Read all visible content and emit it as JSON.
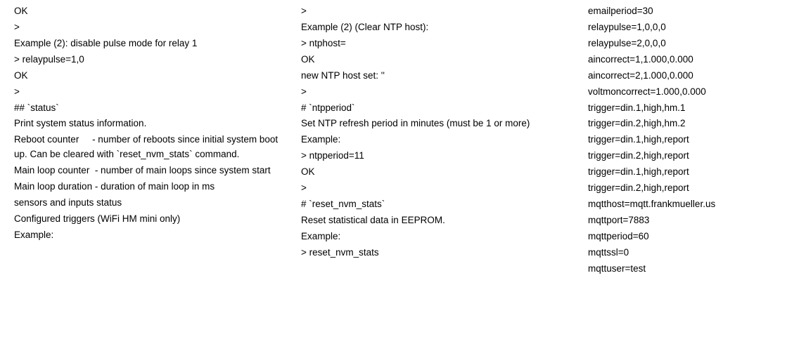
{
  "col1": [
    "OK",
    ">",
    "Example (2): disable pulse mode for relay 1",
    "> relaypulse=1,0",
    "OK",
    ">",
    "## `status`",
    "Print system status information.",
    "Reboot counter     - number of reboots since initial system boot up. Can be cleared with `reset_nvm_stats` command.",
    "Main loop counter  - number of main loops since system start",
    "Main loop duration - duration of main loop in ms",
    "sensors and inputs status",
    "Configured triggers (WiFi HM mini only)",
    "Example:"
  ],
  "col2": [
    ">",
    "Example (2) (Clear NTP host):",
    "> ntphost=",
    "OK",
    "new NTP host set: ''",
    ">",
    "# `ntpperiod`",
    "Set NTP refresh period in minutes (must be 1 or more)",
    "Example:",
    "> ntpperiod=11",
    "OK",
    ">",
    "# `reset_nvm_stats`",
    "Reset statistical data in EEPROM.",
    "Example:",
    "> reset_nvm_stats"
  ],
  "col3": [
    "emailperiod=30",
    "relaypulse=1,0,0,0",
    "relaypulse=2,0,0,0",
    "aincorrect=1,1.000,0.000",
    "aincorrect=2,1.000,0.000",
    "voltmoncorrect=1.000,0.000",
    "trigger=din.1,high,hm.1",
    "trigger=din.2,high,hm.2",
    "trigger=din.1,high,report",
    "trigger=din.2,high,report",
    "trigger=din.1,high,report",
    "trigger=din.2,high,report",
    "mqtthost=mqtt.frankmueller.us",
    "mqttport=7883",
    "mqttperiod=60",
    "mqttssl=0",
    "mqttuser=test"
  ]
}
